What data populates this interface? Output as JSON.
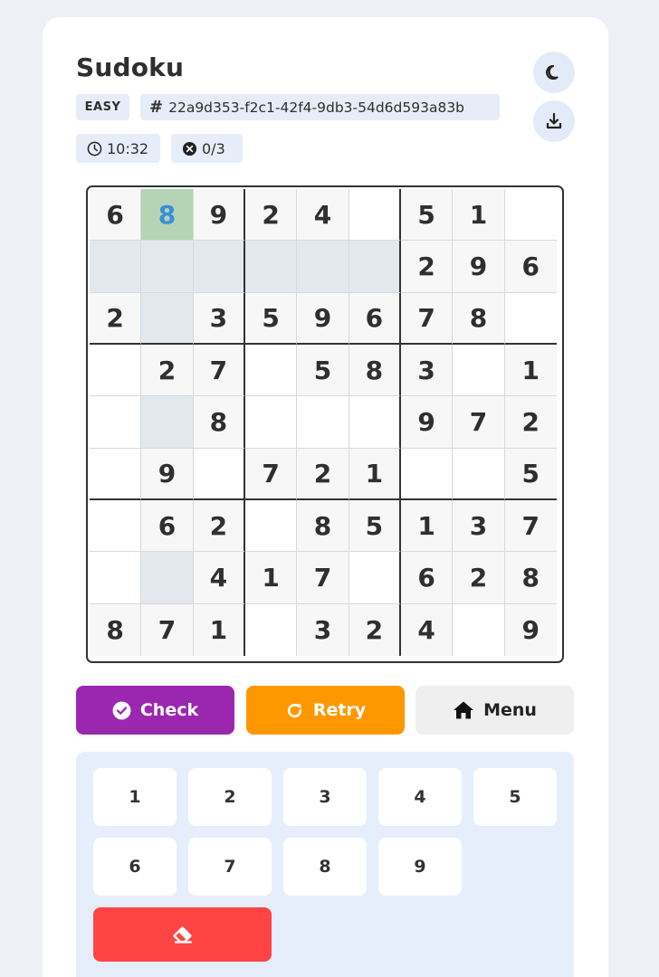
{
  "header": {
    "title": "Sudoku",
    "difficulty": "EASY",
    "hash_symbol": "#",
    "puzzle_id": "22a9d353-f2c1-42f4-9db3-54d6d593a83b",
    "timer": "10:32",
    "mistakes": "0/3"
  },
  "icons": {
    "theme": "moon-icon",
    "download": "download-icon",
    "timer": "clock-icon",
    "mistakes": "x-circle-icon",
    "check": "check-circle-icon",
    "retry": "redo-icon",
    "menu": "home-icon",
    "erase": "eraser-icon"
  },
  "board": {
    "rows": [
      [
        "6",
        "8",
        "9",
        "2",
        "4",
        "",
        "5",
        "1",
        ""
      ],
      [
        "",
        "",
        "",
        "",
        "",
        "",
        "2",
        "9",
        "6"
      ],
      [
        "2",
        "",
        "3",
        "5",
        "9",
        "6",
        "7",
        "8",
        ""
      ],
      [
        "",
        "2",
        "7",
        "",
        "5",
        "8",
        "3",
        "",
        "1"
      ],
      [
        "",
        "",
        "8",
        "",
        "",
        "",
        "9",
        "7",
        "2"
      ],
      [
        "",
        "9",
        "",
        "7",
        "2",
        "1",
        "",
        "",
        "5"
      ],
      [
        "",
        "6",
        "2",
        "",
        "8",
        "5",
        "1",
        "3",
        "7"
      ],
      [
        "",
        "",
        "4",
        "1",
        "7",
        "",
        "6",
        "2",
        "8"
      ],
      [
        "8",
        "7",
        "1",
        "",
        "3",
        "2",
        "4",
        "",
        "9"
      ]
    ],
    "selected": [
      0,
      1
    ],
    "highlighted": [
      [
        1,
        0
      ],
      [
        1,
        1
      ],
      [
        1,
        2
      ],
      [
        1,
        3
      ],
      [
        1,
        4
      ],
      [
        1,
        5
      ],
      [
        2,
        1
      ],
      [
        4,
        1
      ],
      [
        7,
        1
      ]
    ]
  },
  "actions": {
    "check_label": "Check",
    "retry_label": "Retry",
    "menu_label": "Menu"
  },
  "keypad": {
    "keys": [
      "1",
      "2",
      "3",
      "4",
      "5",
      "6",
      "7",
      "8",
      "9"
    ]
  },
  "colors": {
    "check": "#9b27b0",
    "retry": "#ff9800",
    "erase": "#ff4444",
    "selected_cell": "#b5d4b5",
    "selected_digit": "#3a8fd8"
  }
}
